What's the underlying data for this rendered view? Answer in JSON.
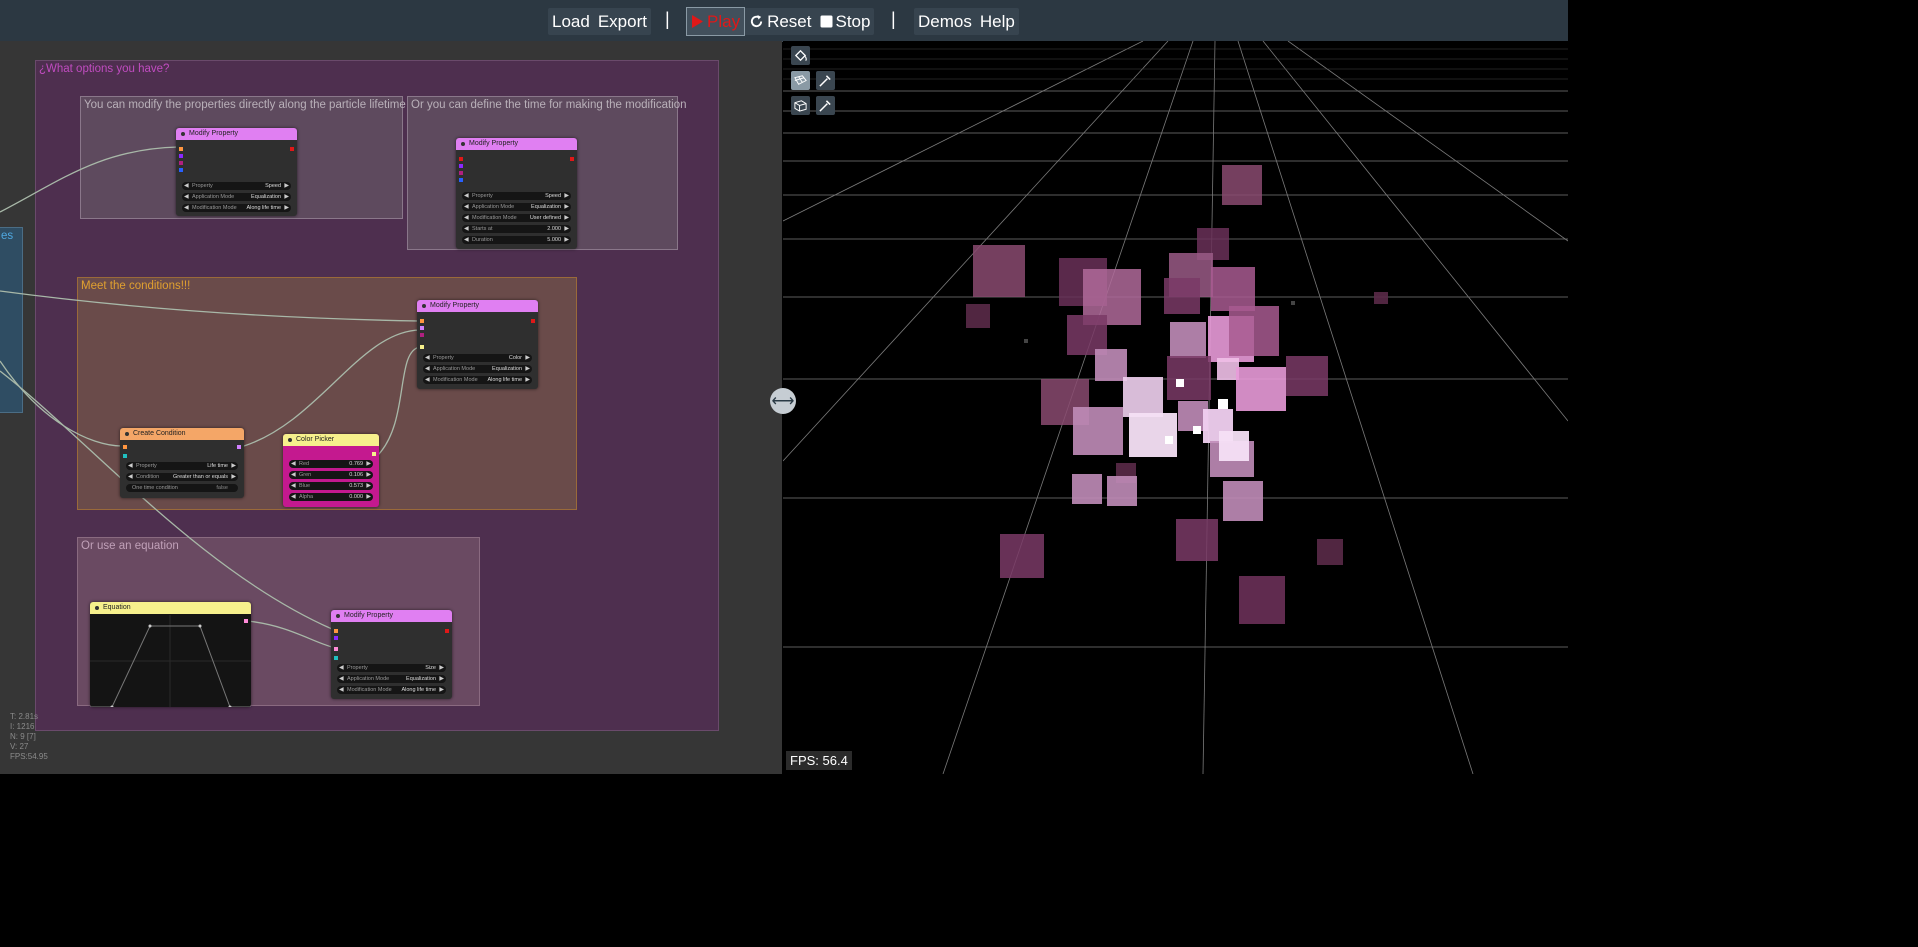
{
  "toolbar": {
    "load": "Load",
    "export": "Export",
    "play": "Play",
    "reset": "Reset",
    "stop": "Stop",
    "demos": "Demos",
    "help": "Help",
    "separator": "|"
  },
  "graph": {
    "left_tab_label": "es",
    "groups": {
      "main": "¿What options you have?",
      "lifetime": "You can modify the properties directly along the particle lifetime",
      "time": "Or you can define the time for making the modification",
      "conditions": "Meet the conditions!!!",
      "equation": "Or use an equation"
    },
    "nodes": {
      "mp1": {
        "title": "Modify Property",
        "w1_label": "Property",
        "w1_value": "Speed",
        "w2_label": "Application Mode",
        "w2_value": "Equalization",
        "w3_label": "Modification Mode",
        "w3_value": "Along life time"
      },
      "mp2": {
        "title": "Modify Property",
        "w1_label": "Property",
        "w1_value": "Speed",
        "w2_label": "Application Mode",
        "w2_value": "Equalization",
        "w3_label": "Modification Mode",
        "w3_value": "User defined",
        "w4_label": "Starts at",
        "w4_value": "2.000",
        "w5_label": "Duration",
        "w5_value": "5.000"
      },
      "mp3": {
        "title": "Modify Property",
        "w1_label": "Property",
        "w1_value": "Color",
        "w2_label": "Application Mode",
        "w2_value": "Equalization",
        "w3_label": "Modification Mode",
        "w3_value": "Along life time"
      },
      "cond": {
        "title": "Create Condition",
        "w1_label": "Property",
        "w1_value": "Life time",
        "w2_label": "Condition",
        "w2_value": "Greater than or equals",
        "w3_label": "One time condition",
        "w3_value": "false"
      },
      "color": {
        "title": "Color Picker",
        "w1_label": "Red",
        "w1_value": "0.769",
        "w2_label": "Gren",
        "w2_value": "0.106",
        "w3_label": "Blue",
        "w3_value": "0.573",
        "w4_label": "Alpha",
        "w4_value": "0.000"
      },
      "eq": {
        "title": "Equation"
      },
      "mp4": {
        "title": "Modify Property",
        "w1_label": "Property",
        "w1_value": "Size",
        "w2_label": "Application Mode",
        "w2_value": "Equalization",
        "w3_label": "Modification Mode",
        "w3_value": "Along life time"
      }
    },
    "stats": {
      "t": "T: 2.81s",
      "i": "I: 1216",
      "n": "N: 9 [7]",
      "v": "V: 27",
      "fps": "FPS:54.95"
    }
  },
  "viewport": {
    "fps": "FPS: 56.4",
    "tools": [
      "paint-bucket-icon",
      "plane-grid-icon",
      "eyedropper-icon",
      "box-grid-icon",
      "eyedropper-icon"
    ]
  },
  "colors": {
    "accent_play": "#e01818",
    "node_header_modify": "#e07ff2",
    "node_header_condition": "#f4a667",
    "node_header_picker": "#f6f08c",
    "group_main": "#4e2f4f",
    "particle": "#e89ad8"
  }
}
